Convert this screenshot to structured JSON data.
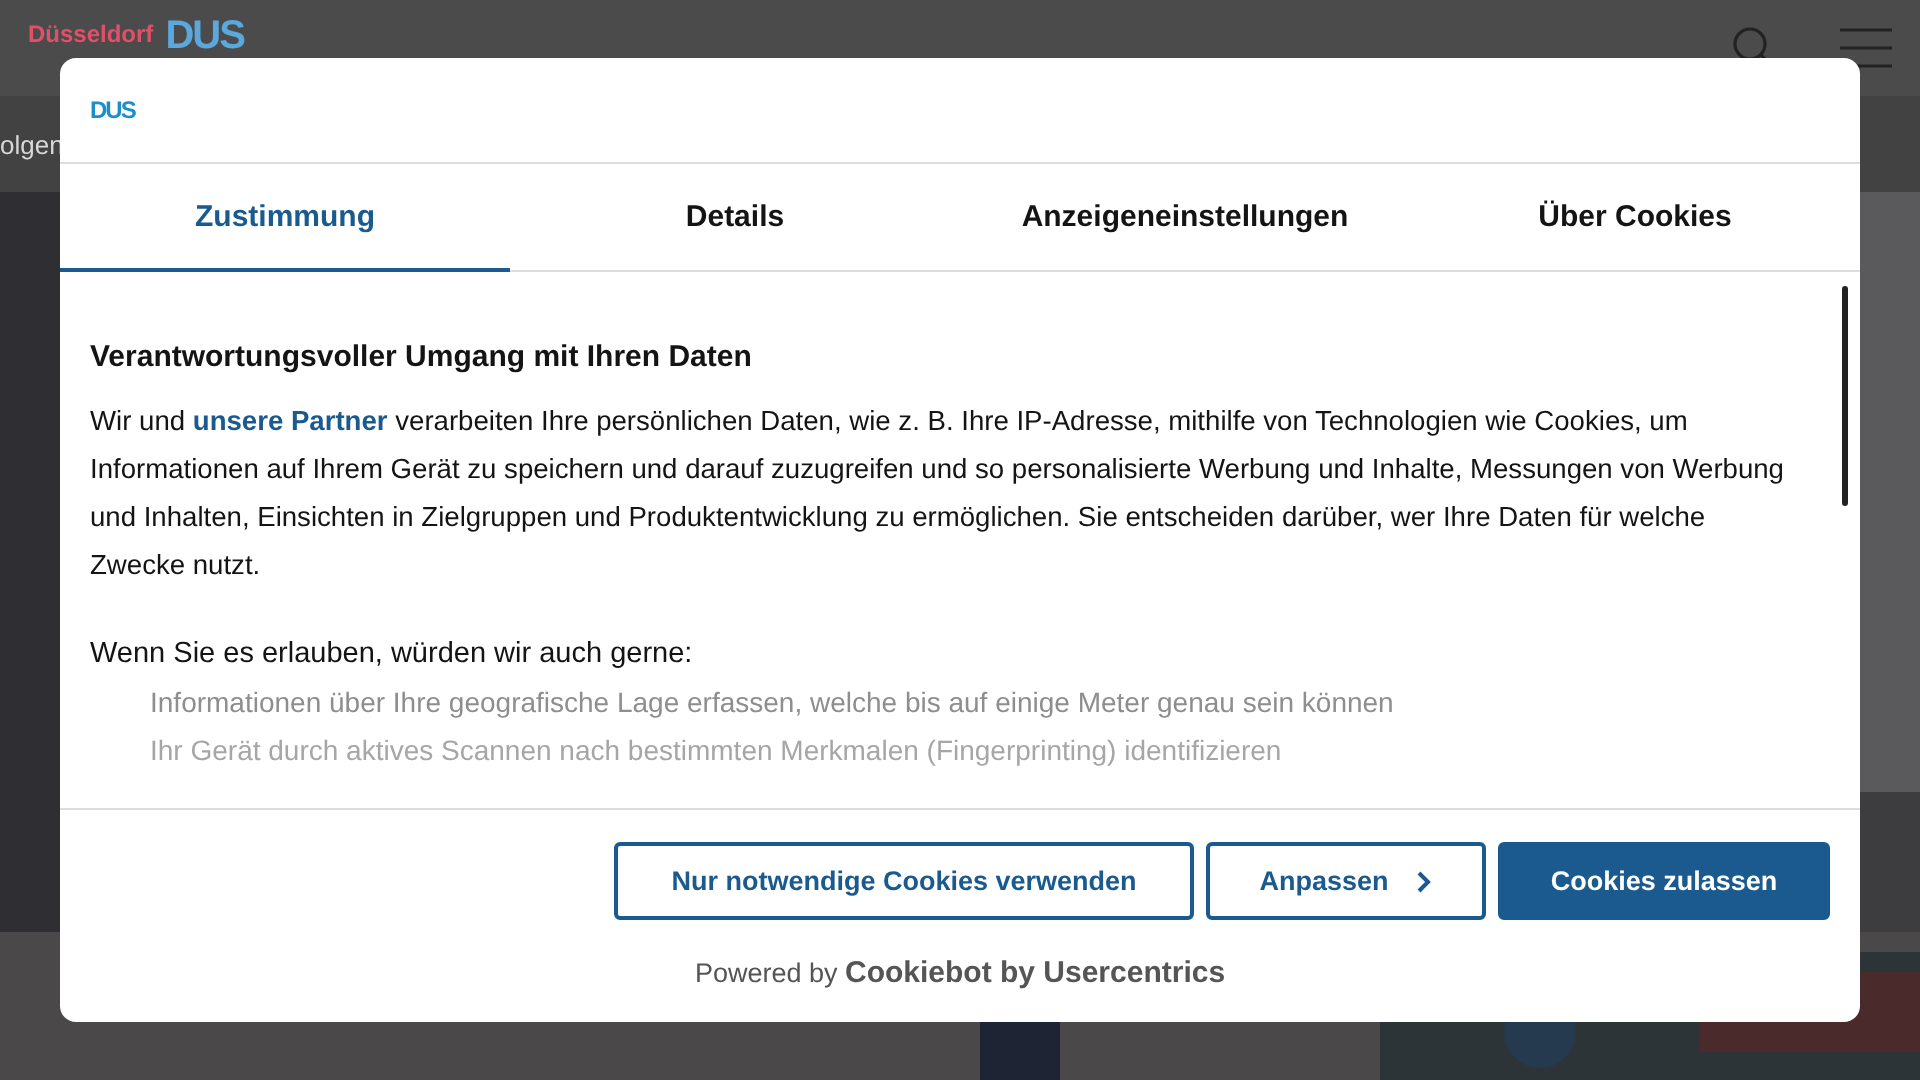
{
  "site_header": {
    "logo_text": "Düsseldorf",
    "logo_mark": "DUS"
  },
  "breadcrumb": {
    "text": "olgen"
  },
  "dialog": {
    "logo": "DUS",
    "tabs": [
      {
        "label": "Zustimmung",
        "selected": true
      },
      {
        "label": "Details",
        "selected": false
      },
      {
        "label": "Anzeigeneinstellungen",
        "selected": false
      },
      {
        "label": "Über Cookies",
        "selected": false
      }
    ],
    "heading": "Verantwortungsvoller Umgang mit Ihren Daten",
    "intro_before": "Wir und",
    "intro_link": "unsere Partner",
    "intro_after": "verarbeiten Ihre persönlichen Daten, wie z. B. Ihre IP-Adresse, mithilfe von Technologien wie Cookies, um Informationen auf Ihrem Gerät zu speichern und darauf zuzugreifen und so personalisierte Werbung und Inhalte, Messungen von Werbung und Inhalten, Einsichten in Zielgruppen und Produktentwicklung zu ermöglichen. Sie entscheiden darüber, wer Ihre Daten für welche Zwecke nutzt.",
    "list_heading": "Wenn Sie es erlauben, würden wir auch gerne:",
    "list_items": [
      "Informationen über Ihre geografische Lage erfassen, welche bis auf einige Meter genau sein können",
      "Ihr Gerät durch aktives Scannen nach bestimmten Merkmalen (Fingerprinting) identifizieren"
    ],
    "buttons": [
      {
        "label": "Nur notwendige Cookies verwenden",
        "kind": "outline"
      },
      {
        "label": "Anpassen",
        "kind": "chevron"
      },
      {
        "label": "Cookies zulassen",
        "kind": "primary"
      }
    ],
    "powered_by": "Powered by",
    "brand": "Cookiebot by Usercentrics"
  }
}
